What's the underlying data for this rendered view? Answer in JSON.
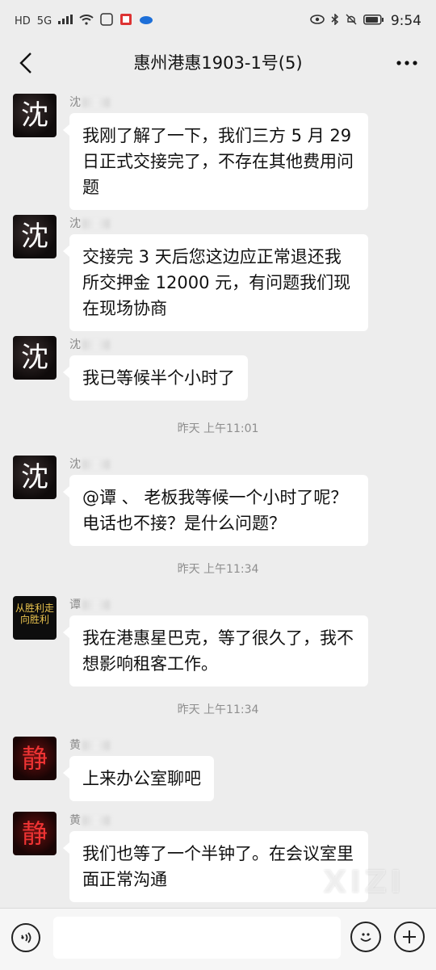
{
  "status_bar": {
    "left_icons": [
      "HD",
      "5G"
    ],
    "time": "9:54"
  },
  "header": {
    "title": "惠州港惠1903-1号(5)",
    "back_icon": "chevron-left-icon",
    "more_icon": "more-dots-icon"
  },
  "messages": [
    {
      "sender": "沈",
      "avatar_text": "沈",
      "text": "我刚了解了一下，我们三方 5 月 29 日正式交接完了，不存在其他费用问题"
    },
    {
      "sender": "沈",
      "avatar_text": "沈",
      "text": "交接完 3 天后您这边应正常退还我所交押金 12000 元，有问题我们现在现场协商"
    },
    {
      "sender": "沈",
      "avatar_text": "沈",
      "text": "我已等候半个小时了"
    },
    {
      "sender": "沈",
      "avatar_text": "沈",
      "text": "@谭  、 老板我等候一个小时了呢？电话也不接？是什么问题？"
    },
    {
      "sender": "谭",
      "avatar_text": "从胜利走向胜利",
      "text": "我在港惠星巴克，等了很久了，我不想影响租客工作。"
    },
    {
      "sender": "黄",
      "avatar_text": "静",
      "text": "上来办公室聊吧"
    },
    {
      "sender": "黄",
      "avatar_text": "静",
      "text": "我们也等了一个半钟了。在会议室里面正常沟通"
    }
  ],
  "timestamps": [
    "昨天 上午11:01",
    "昨天 上午11:34",
    "昨天 上午11:34"
  ],
  "bottom_bar": {
    "voice_icon": "voice-icon",
    "emoji_icon": "emoji-icon",
    "plus_icon": "plus-icon"
  },
  "watermark": "XIZI"
}
